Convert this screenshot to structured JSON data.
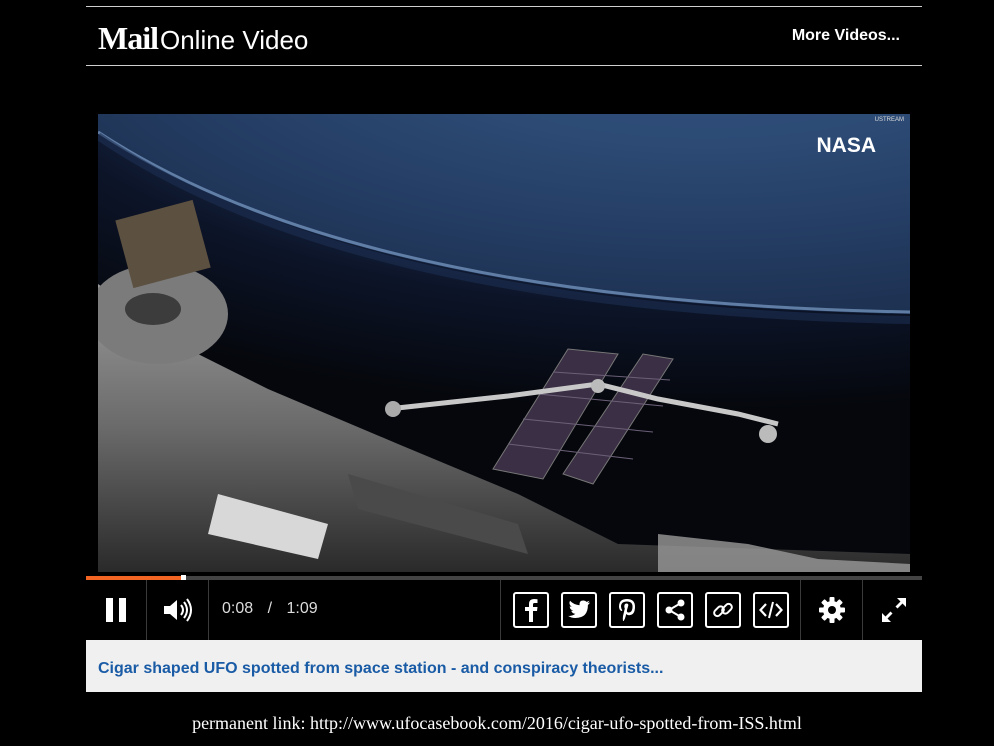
{
  "header": {
    "logo_mail": "Mail",
    "logo_online": "Online Video",
    "more_videos": "More Videos..."
  },
  "video": {
    "watermark": "NASA",
    "ustream": "USTREAM"
  },
  "controls": {
    "current_time": "0:08",
    "separator": "/",
    "duration": "1:09",
    "progress_fraction": 0.116
  },
  "title": "Cigar shaped UFO spotted from space station - and conspiracy theorists...",
  "permalink": "permanent link: http://www.ufocasebook.com/2016/cigar-ufo-spotted-from-ISS.html",
  "colors": {
    "accent": "#f26522",
    "title_link": "#1a5ba6"
  },
  "icons": [
    "pause-icon",
    "volume-icon",
    "facebook-icon",
    "twitter-icon",
    "pinterest-icon",
    "share-icon",
    "link-icon",
    "embed-icon",
    "settings-icon",
    "fullscreen-icon"
  ]
}
